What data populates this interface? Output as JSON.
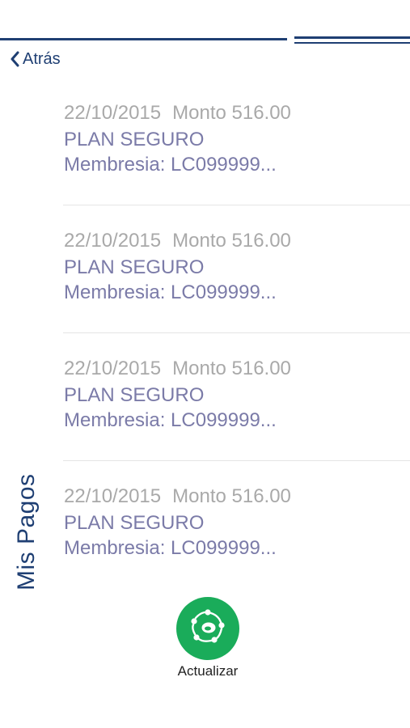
{
  "nav": {
    "back_label": "Atrás"
  },
  "side_title": "Mis Pagos",
  "payments": [
    {
      "date": "22/10/2015",
      "amount": "Monto 516.00",
      "plan": "PLAN SEGURO",
      "membership": "Membresia: LC099999..."
    },
    {
      "date": "22/10/2015",
      "amount": "Monto 516.00",
      "plan": "PLAN SEGURO",
      "membership": "Membresia: LC099999..."
    },
    {
      "date": "22/10/2015",
      "amount": "Monto 516.00",
      "plan": "PLAN SEGURO",
      "membership": "Membresia: LC099999..."
    },
    {
      "date": "22/10/2015",
      "amount": "Monto 516.00",
      "plan": "PLAN SEGURO",
      "membership": "Membresia: LC099999..."
    }
  ],
  "refresh": {
    "label": "Actualizar",
    "icon": "refresh-cycle-icon",
    "color": "#1aac5a"
  },
  "colors": {
    "brand": "#1f3f73",
    "muted": "#a9a9a9",
    "accent_text": "#7b7ba8"
  }
}
